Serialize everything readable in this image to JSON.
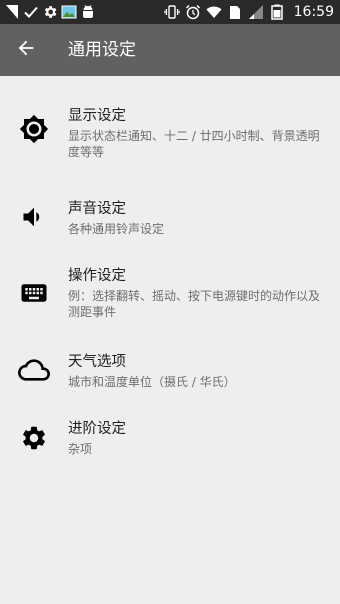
{
  "status_bar": {
    "time": "16:59",
    "left_icons": [
      "sim-card-icon",
      "check-icon",
      "gear-icon",
      "gallery-icon",
      "android-bug-icon"
    ],
    "right_icons": [
      "vibrate-icon",
      "alarm-icon",
      "wifi-icon",
      "sim-signal-icon",
      "signal-bars-icon",
      "battery-icon"
    ]
  },
  "toolbar": {
    "back_icon": "arrow-back-icon",
    "title": "通用设定"
  },
  "settings": [
    {
      "icon": "brightness-icon",
      "title": "显示设定",
      "subtitle": "显示状态栏通知、十二 / 廿四小时制、背景透明度等等"
    },
    {
      "icon": "volume-icon",
      "title": "声音设定",
      "subtitle": "各种通用铃声设定"
    },
    {
      "icon": "keyboard-icon",
      "title": "操作设定",
      "subtitle": "例：选择翻转、摇动、按下电源键时的动作以及测距事件"
    },
    {
      "icon": "cloud-icon",
      "title": "天气选项",
      "subtitle": "城市和温度单位（摄氏 / 华氏）"
    },
    {
      "icon": "settings-gear-icon",
      "title": "进阶设定",
      "subtitle": "杂项"
    }
  ],
  "colors": {
    "status_bar_bg": "#2a2a2a",
    "toolbar_bg": "#616161",
    "page_bg": "#eeeeee",
    "title_text": "#212121",
    "subtitle_text": "#6e6e6e"
  }
}
